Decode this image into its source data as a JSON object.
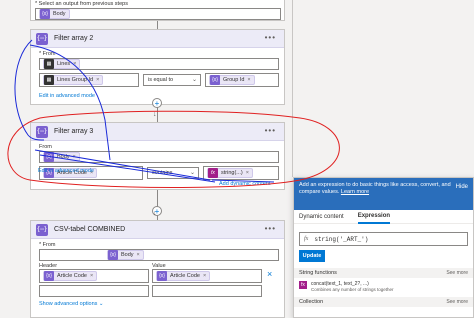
{
  "top": {
    "select_label": "* Select an output from previous steps",
    "body_token": "Body"
  },
  "filter2": {
    "title": "Filter array 2",
    "from_label": "* From",
    "from_token": "Lines",
    "left_token": "Lines Group Id",
    "operator": "is equal to",
    "right_token": "Group Id",
    "advanced_link": "Edit in advanced mode"
  },
  "filter3": {
    "title": "Filter array 3",
    "from_label": "From",
    "from_token": "Body",
    "left_token": "Article Code",
    "operator": "contains",
    "right_token": "string(...)",
    "add_dynamic": "Add dynamic content",
    "advanced_link": "Edit in advanced mode"
  },
  "csv": {
    "title": "CSV-tabel COMBINED",
    "from_label": "* From",
    "from_token": "Body",
    "header_label": "Header",
    "value_label": "Value",
    "header_token": "Article Code",
    "value_token": "Article Code",
    "advanced_link": "Show advanced options"
  },
  "panel": {
    "banner": "Add an expression to do basic things like access, convert, and compare values.",
    "learn_more": "Learn more",
    "hide": "Hide",
    "tab_dynamic": "Dynamic content",
    "tab_expression": "Expression",
    "expression": "string('_ART_')",
    "update_btn": "Update",
    "string_functions": "String functions",
    "see_more_1": "See more",
    "fn_name": "concat(text_1, text_2?, ...)",
    "fn_desc": "Combines any number of strings together",
    "collection": "Collection",
    "see_more_2": "See more"
  },
  "colors": {
    "accent": "#7b61d0",
    "blue": "#0078d4",
    "annotation_red": "#e02020",
    "annotation_blue": "#1a2ad8"
  },
  "icons": {
    "op": "curly-braces-icon",
    "fx": "fx-icon"
  }
}
